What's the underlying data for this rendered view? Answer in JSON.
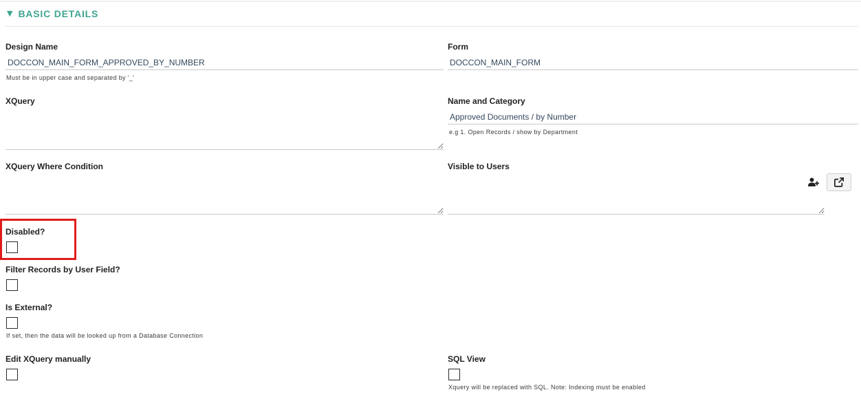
{
  "section": {
    "toggle_icon": "▼",
    "title": "BASIC DETAILS"
  },
  "fields": {
    "design_name": {
      "label": "Design Name",
      "value": "DOCCON_MAIN_FORM_APPROVED_BY_NUMBER",
      "help": "Must be in upper case and separated by '_'"
    },
    "form": {
      "label": "Form",
      "value": "DOCCON_MAIN_FORM"
    },
    "xquery": {
      "label": "XQuery",
      "value": ""
    },
    "name_and_category": {
      "label": "Name and Category",
      "value": "Approved Documents / by Number",
      "help": "e.g 1. Open Records / show by Department"
    },
    "xquery_where_condition": {
      "label": "XQuery Where Condition",
      "value": ""
    },
    "visible_to_users": {
      "label": "Visible to Users",
      "value": "",
      "add_user_icon": "user-plus-icon",
      "open_icon": "external-link-icon"
    },
    "disabled": {
      "label": "Disabled?",
      "checked": false
    },
    "filter_records_by_user_field": {
      "label": "Filter Records by User Field?",
      "checked": false
    },
    "is_external": {
      "label": "Is External?",
      "checked": false,
      "help": "If set, then the data will be looked up from a Database Connection"
    },
    "edit_xquery_manually": {
      "label": "Edit XQuery manually",
      "checked": false
    },
    "sql_view": {
      "label": "SQL View",
      "checked": false,
      "help": "Xquery will be replaced with SQL. Note: Indexing must be enabled"
    }
  },
  "highlight": {
    "color": "#e01b1b"
  },
  "colors": {
    "section_title": "#3fa590",
    "label": "#222222",
    "value": "#34495e",
    "help": "#3a3a3a",
    "underline": "#c9c9c9",
    "divider": "#e8e8e8"
  }
}
